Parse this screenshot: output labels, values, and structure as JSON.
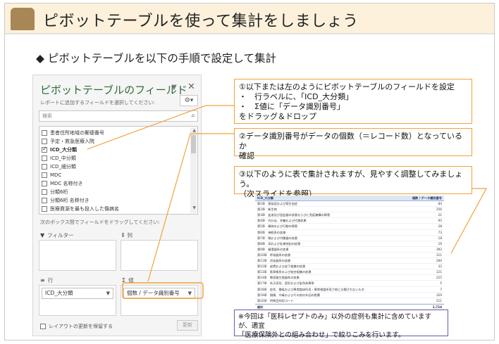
{
  "slide": {
    "title": "ピボットテーブルを使って集計をしましょう",
    "subheading": "◆ ピボットテーブルを以下の手順で設定して集計"
  },
  "pane": {
    "title": "ピボットテーブルのフィールド",
    "hint": "レポートに追加するフィールドを選択してください:",
    "search_placeholder": "検索",
    "fields": [
      {
        "label": "患者住所地域の郵便番号",
        "checked": false
      },
      {
        "label": "予定・救急医療入院",
        "checked": false
      },
      {
        "label": "ICD_大分類",
        "checked": true
      },
      {
        "label": "ICD_中分類",
        "checked": false
      },
      {
        "label": "ICD_細分類",
        "checked": false
      },
      {
        "label": "MDC",
        "checked": false
      },
      {
        "label": "MDC 名称付き",
        "checked": false
      },
      {
        "label": "分類6桁",
        "checked": false
      },
      {
        "label": "分類6桁 名称付き",
        "checked": false
      },
      {
        "label": "医療資源を最も投入した傷病名",
        "checked": false
      }
    ],
    "drag_hint": "次のボックス間でフィールドをドラッグしてください:",
    "filter_label": "フィルター",
    "column_label": "列",
    "row_label": "行",
    "value_label": "値",
    "row_chip": "ICD_大分類",
    "value_chip": "個数 / データ識別番号",
    "defer_label": "レイアウトの更新を保留する",
    "update_button": "更新"
  },
  "callouts": {
    "step1": {
      "line1": "①以下または左のようにピボットテーブルのフィールドを設定",
      "line2": "・　行ラベルに、「ICD_大分類」",
      "line3": "・　Σ値に「データ識別番号」",
      "line4": "をドラッグ＆ドロップ"
    },
    "step2": {
      "line1": "②データ識別番号がデータの個数（＝レコード数）となっているか",
      "line2": "確認"
    },
    "step3": {
      "line1": "③以下のように表で集計されますが、見やすく調整してみましょう。",
      "line2": "（次スライドを参照）"
    },
    "note": {
      "line1": "※今回は「医科レセプトのみ」以外の症例も集計に含めていますが、適宜",
      "line2": "「医療保険外との組み合わせ」で絞りこみを行います。"
    }
  },
  "table": {
    "header": [
      "ICD_大分類",
      "個数 / データ識別番号"
    ],
    "rows": [
      [
        "第1章　感染症および寄生虫症",
        "84"
      ],
      [
        "第2章　新生物",
        "256"
      ],
      [
        "第3章　血液及び造血器の疾患ならびに免疫機構の障害",
        "21"
      ],
      [
        "第4章　内分泌、栄養および代謝疾患",
        "95"
      ],
      [
        "第5章　精神および行動の障害",
        "28"
      ],
      [
        "第6章　神経系の疾患",
        "73"
      ],
      [
        "第7章　眼および付属器の疾患",
        "18"
      ],
      [
        "第8章　耳および乳様突起の疾患",
        "16"
      ],
      [
        "第9章　循環器系の疾患",
        "392"
      ],
      [
        "第10章　呼吸器系の疾患",
        "311"
      ],
      [
        "第11章　消化器系の疾患",
        "260"
      ],
      [
        "第12章　皮膚および皮下組織の疾患",
        "32"
      ],
      [
        "第13章　筋骨格系および結合組織の疾患",
        "121"
      ],
      [
        "第14章　腎尿路生殖器系の疾患",
        "225"
      ],
      [
        "第17章　先天奇形、変形および染色体異常",
        "5"
      ],
      [
        "第18章　症状、徴候および異常臨床所見・異常検査所見で他に分類されないもの",
        "7"
      ],
      [
        "第19章　損傷、中毒およびその他の外因の影響",
        "329"
      ],
      [
        "第22章　特殊目的用コード",
        "211"
      ]
    ],
    "total_label": "総計",
    "total_value": "2,724"
  },
  "colors": {
    "title_band": "#fdf1dc",
    "title_badge": "#a88656",
    "callout_border": "#f2a23a",
    "note_border": "#6b5aa8",
    "pane_title": "#2f6b3a"
  }
}
